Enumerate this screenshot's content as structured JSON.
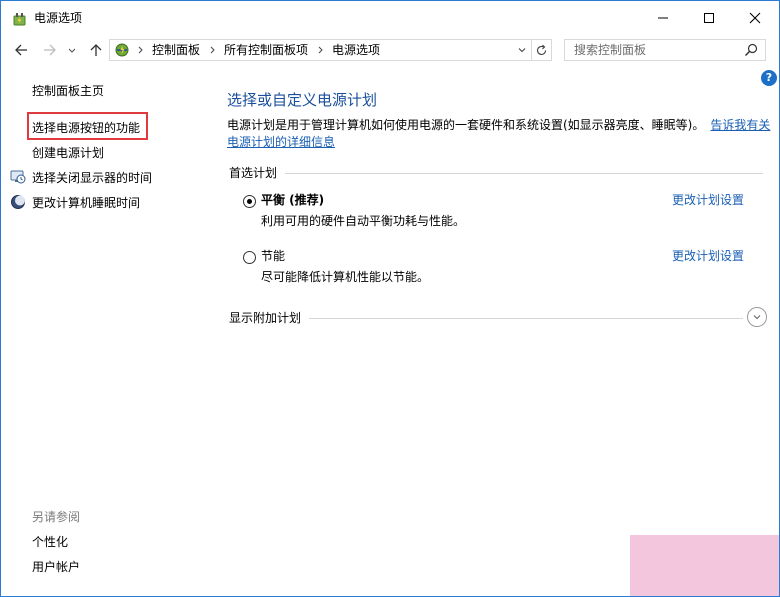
{
  "window": {
    "title": "电源选项"
  },
  "address": {
    "crumbs": [
      "控制面板",
      "所有控制面板项",
      "电源选项"
    ],
    "search_placeholder": "搜索控制面板"
  },
  "sidebar": {
    "home": "控制面板主页",
    "items": [
      {
        "label": "选择电源按钮的功能"
      },
      {
        "label": "创建电源计划"
      },
      {
        "label": "选择关闭显示器的时间"
      },
      {
        "label": "更改计算机睡眠时间"
      }
    ],
    "see_also_title": "另请参阅",
    "see_also": [
      {
        "label": "个性化"
      },
      {
        "label": "用户帐户"
      }
    ]
  },
  "main": {
    "title": "选择或自定义电源计划",
    "description_line1": "电源计划是用于管理计算机如何使用电源的一套硬件和系统设置(如显示器亮度、睡眠等)。",
    "description_link_part1": "告诉我有关",
    "description_link_part2": "电源计划的详细信息",
    "preferred_header": "首选计划",
    "plans": [
      {
        "name": "平衡 (推荐)",
        "description": "利用可用的硬件自动平衡功耗与性能。",
        "link": "更改计划设置",
        "selected": true
      },
      {
        "name": "节能",
        "description": "尽可能降低计算机性能以节能。",
        "link": "更改计划设置",
        "selected": false
      }
    ],
    "more_plans_header": "显示附加计划"
  },
  "colors": {
    "accent": "#1a5fb4",
    "title": "#1a4f9c",
    "highlight": "#e0393e",
    "border": "#2b7bd3"
  }
}
